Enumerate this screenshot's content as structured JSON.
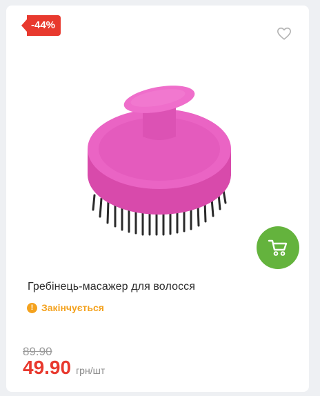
{
  "badge": {
    "discount": "-44%"
  },
  "product": {
    "title": "Гребінець-масажер для волосся",
    "status": "Закінчується",
    "old_price": "89.90",
    "price": "49.90",
    "unit": "грн/шт"
  },
  "colors": {
    "accent_red": "#e8392e",
    "cart_green": "#64b33d",
    "warning_orange": "#f4a21e",
    "product_pink": "#e85ec0"
  },
  "icons": {
    "favorite": "heart-outline-icon",
    "cart": "cart-icon",
    "status": "warning-circle-icon"
  }
}
